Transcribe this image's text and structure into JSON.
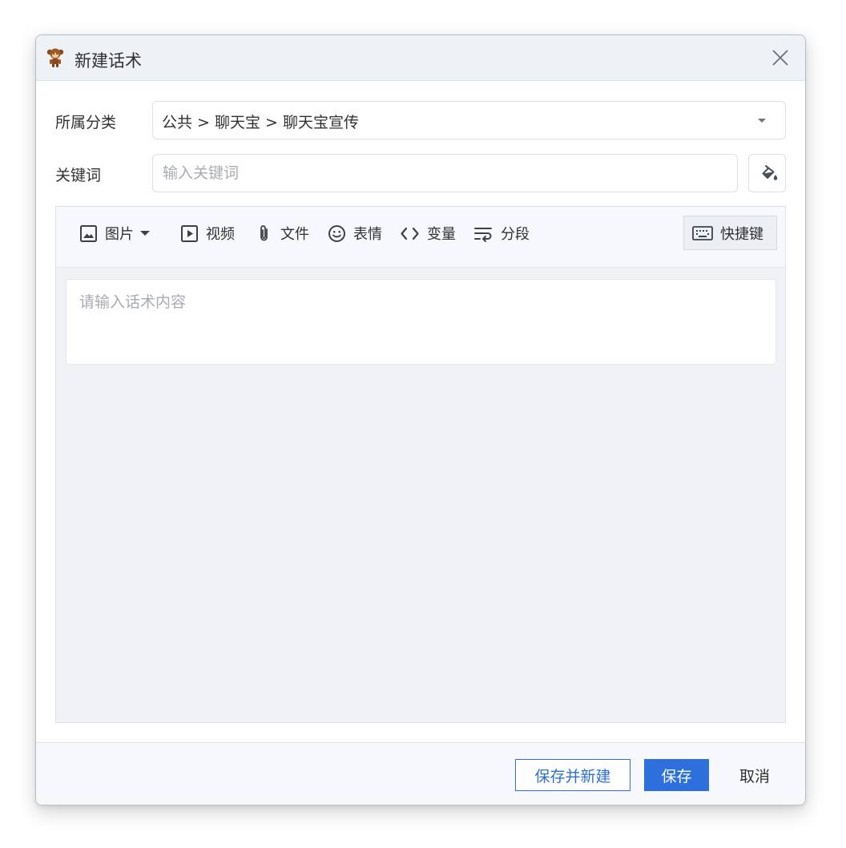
{
  "dialog": {
    "title": "新建话术",
    "app_icon": "monkey-icon",
    "close_icon": "close-icon"
  },
  "form": {
    "category_label": "所属分类",
    "category_value": "公共 > 聊天宝 > 聊天宝宣传",
    "keyword_label": "关键词",
    "keyword_placeholder": "输入关键词",
    "keyword_value": ""
  },
  "toolbar": {
    "image": "图片",
    "video": "视频",
    "file": "文件",
    "emoji": "表情",
    "variable": "变量",
    "segment": "分段",
    "shortcut": "快捷键"
  },
  "editor": {
    "placeholder": "请输入话术内容",
    "value": ""
  },
  "footer": {
    "save_new": "保存并新建",
    "save": "保存",
    "cancel": "取消"
  },
  "colors": {
    "primary": "#2d6fdd",
    "titlebar_bg": "#eef1f6",
    "editor_bg": "#f0f2f6"
  }
}
